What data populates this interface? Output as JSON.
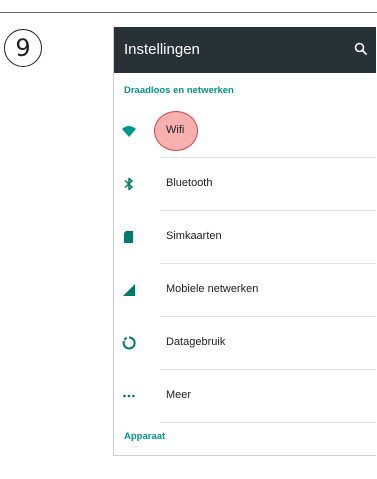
{
  "step": {
    "number": "9"
  },
  "appbar": {
    "title": "Instellingen",
    "search_icon": "search-icon"
  },
  "sections": {
    "wireless": "Draadloos en netwerken",
    "device": "Apparaat"
  },
  "items": [
    {
      "label": "Wifi",
      "icon": "wifi-icon",
      "highlighted": true
    },
    {
      "label": "Bluetooth",
      "icon": "bluetooth-icon"
    },
    {
      "label": "Simkaarten",
      "icon": "sim-card-icon"
    },
    {
      "label": "Mobiele netwerken",
      "icon": "cellular-signal-icon"
    },
    {
      "label": "Datagebruik",
      "icon": "data-usage-icon"
    },
    {
      "label": "Meer",
      "icon": "more-dots-icon"
    }
  ],
  "colors": {
    "appbar": "#263238",
    "accent": "#009688",
    "highlight": "#f06e6e"
  }
}
